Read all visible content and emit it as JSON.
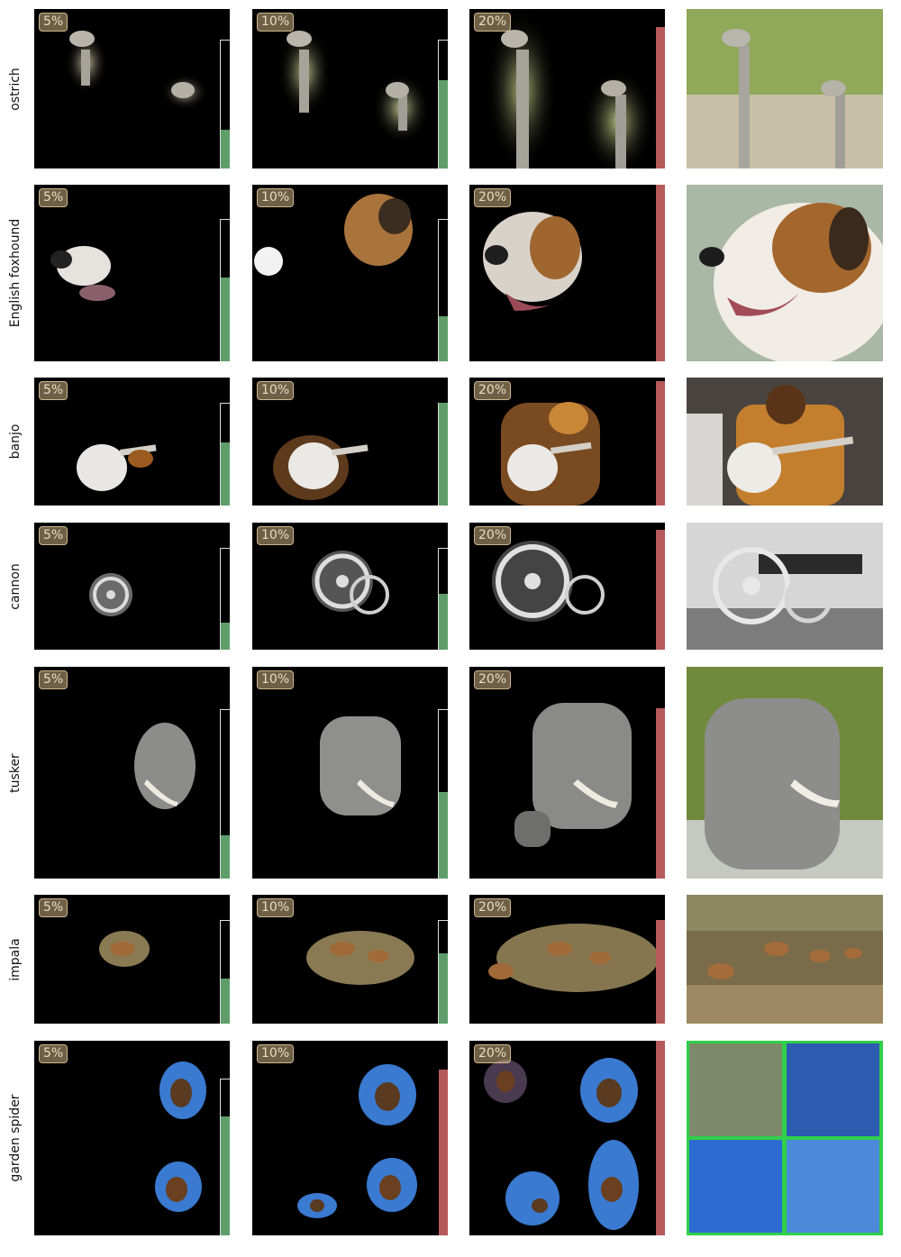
{
  "levels": [
    "5%",
    "10%",
    "20%"
  ],
  "colors": {
    "correct_bar": "#5f9e6a",
    "wrong_bar": "#b55a5a",
    "badge": "#c8af82",
    "grid_border": "#2fd04a"
  },
  "rows": [
    {
      "label": "ostrich",
      "bars": [
        {
          "fill": 0.3,
          "kind": "correct"
        },
        {
          "fill": 0.7,
          "kind": "correct"
        },
        {
          "fill": 1.0,
          "kind": "wrong"
        }
      ]
    },
    {
      "label": "English foxhound",
      "bars": [
        {
          "fill": 0.6,
          "kind": "correct"
        },
        {
          "fill": 0.3,
          "kind": "correct"
        },
        {
          "fill": 1.0,
          "kind": "wrong"
        }
      ]
    },
    {
      "label": "banjo",
      "bars": [
        {
          "fill": 0.6,
          "kind": "correct"
        },
        {
          "fill": 1.0,
          "kind": "correct"
        },
        {
          "fill": 1.0,
          "kind": "wrong"
        }
      ]
    },
    {
      "label": "cannon",
      "bars": [
        {
          "fill": 0.27,
          "kind": "correct"
        },
        {
          "fill": 0.55,
          "kind": "correct"
        },
        {
          "fill": 1.0,
          "kind": "wrong"
        }
      ]
    },
    {
      "label": "tusker",
      "bars": [
        {
          "fill": 0.25,
          "kind": "correct"
        },
        {
          "fill": 0.5,
          "kind": "correct"
        },
        {
          "fill": 1.0,
          "kind": "wrong"
        }
      ]
    },
    {
      "label": "impala",
      "bars": [
        {
          "fill": 0.45,
          "kind": "correct"
        },
        {
          "fill": 0.68,
          "kind": "correct"
        },
        {
          "fill": 1.0,
          "kind": "wrong"
        }
      ]
    },
    {
      "label": "garden spider",
      "bars": [
        {
          "fill": 0.75,
          "kind": "correct"
        },
        {
          "fill": 1.0,
          "kind": "wrong"
        },
        {
          "fill": 1.0,
          "kind": "wrong"
        }
      ]
    }
  ]
}
